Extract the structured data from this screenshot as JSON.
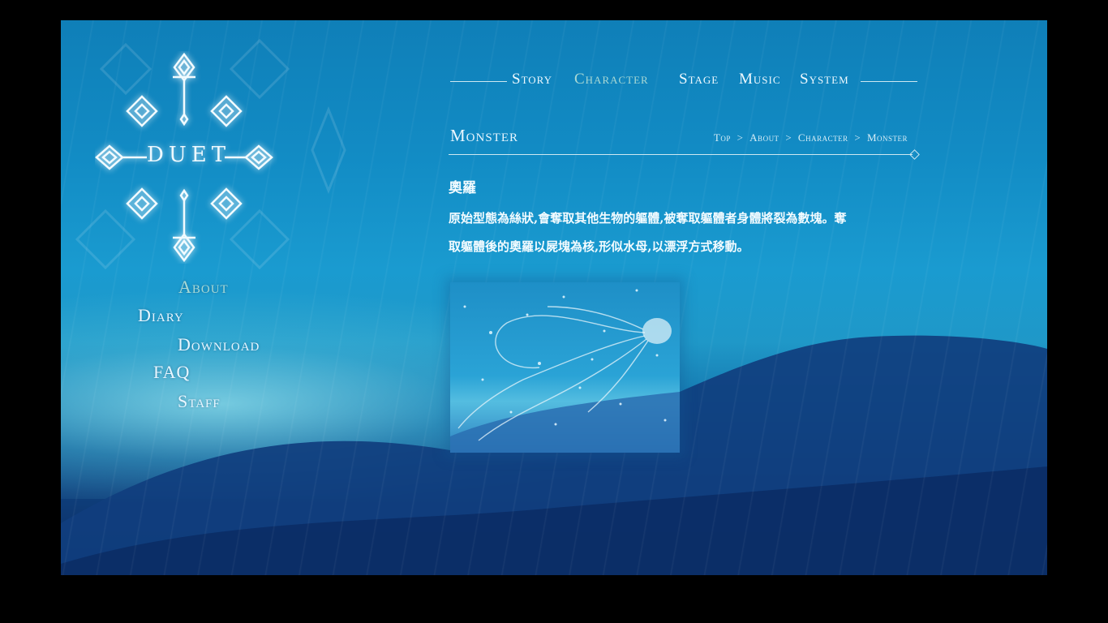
{
  "logo": {
    "text": "DUET"
  },
  "side_nav": [
    {
      "label": "About",
      "active": true
    },
    {
      "label": "Diary",
      "active": false
    },
    {
      "label": "Download",
      "active": false
    },
    {
      "label": "FAQ",
      "active": false
    },
    {
      "label": "Staff",
      "active": false
    }
  ],
  "top_nav": [
    {
      "label": "Story",
      "active": false
    },
    {
      "label": "Character",
      "active": true
    },
    {
      "label": "Stage",
      "active": false
    },
    {
      "label": "Music",
      "active": false
    },
    {
      "label": "System",
      "active": false
    }
  ],
  "page": {
    "title": "Monster",
    "breadcrumb": [
      "Top",
      "About",
      "Character",
      "Monster"
    ],
    "breadcrumb_separator": ">"
  },
  "content": {
    "character_name": "奧羅",
    "description_line1": "原始型態為絲狀,會奪取其他生物的軀體,被奪取軀體者身體將裂為數塊。奪",
    "description_line2": "取軀體後的奧羅以屍塊為核,形似水母,以漂浮方式移動。"
  },
  "colors": {
    "background_top": "#0f7fb8",
    "background_bottom": "#0a2a5e",
    "text": "#e8f6ff",
    "active_link": "#a9d9d5"
  }
}
